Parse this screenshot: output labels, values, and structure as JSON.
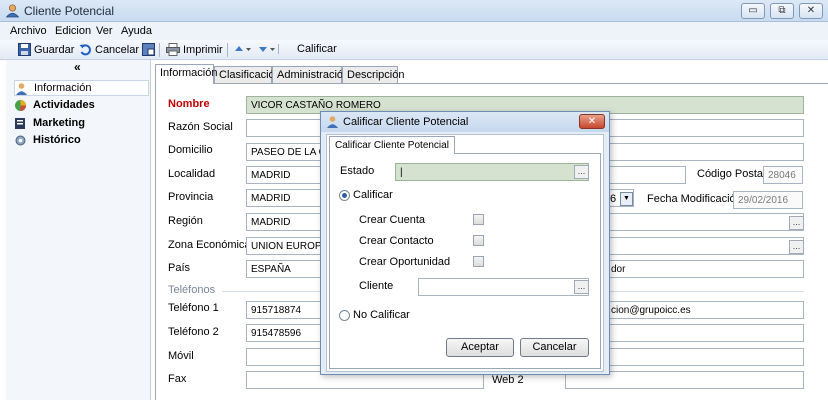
{
  "window": {
    "title": "Cliente Potencial",
    "minimize": "▭",
    "restore": "⧉",
    "close": "✕"
  },
  "menu": [
    "Archivo",
    "Edicion",
    "Ver",
    "Ayuda"
  ],
  "toolbar": {
    "save": "Guardar",
    "cancel": "Cancelar",
    "print": "Imprimir",
    "qualify": "Calificar"
  },
  "nav": {
    "collapse": "«",
    "items": [
      "Información",
      "Actividades",
      "Marketing",
      "Histórico"
    ]
  },
  "tabs": [
    "Información",
    "Clasificación",
    "Administración",
    "Descripción"
  ],
  "form": {
    "nombre_label": "Nombre",
    "nombre_value": "VICOR CASTAÑO ROMERO",
    "razon_label": "Razón Social",
    "domicilio_label": "Domicilio",
    "domicilio_value": "PASEO DE LA CAS",
    "localidad_label": "Localidad",
    "localidad_value": "MADRID",
    "codigo_postal_label": "Código Postal",
    "codigo_postal_value": "28046",
    "provincia_label": "Provincia",
    "provincia_value": "MADRID",
    "fecha_mod_label": "Fecha Modificación",
    "fecha_mod_value": "29/02/2016",
    "combo_digit": "6",
    "region_label": "Región",
    "region_value": "MADRID",
    "zona_label": "Zona Económica",
    "zona_value": "UNION EUROPEA",
    "pais_label": "País",
    "pais_value": "ESPAÑA",
    "pais_right_value": "dor",
    "telefonos_section": "Teléfonos",
    "tel1_label": "Teléfono 1",
    "tel1_value": "915718874",
    "email_value": "cion@grupoicc.es",
    "tel2_label": "Teléfono 2",
    "tel2_value": "915478596",
    "movil_label": "Móvil",
    "fax_label": "Fax",
    "web2_label": "Web 2",
    "ellipsis": "..."
  },
  "dialog": {
    "title": "Calificar Cliente Potencial",
    "close": "✕",
    "tab": "Calificar Cliente Potencial",
    "estado_label": "Estado",
    "estado_value": "|",
    "ellipsis": "...",
    "calificar_label": "Calificar",
    "crear_cuenta": "Crear Cuenta",
    "crear_contacto": "Crear Contacto",
    "crear_oportunidad": "Crear Oportunidad",
    "cliente_label": "Cliente",
    "no_calificar_label": "No Calificar",
    "accept": "Aceptar",
    "cancel": "Cancelar"
  },
  "colors": {
    "required": "#c00000",
    "highlight_field": "#d6e2d0",
    "accent": "#2d5fa6"
  }
}
